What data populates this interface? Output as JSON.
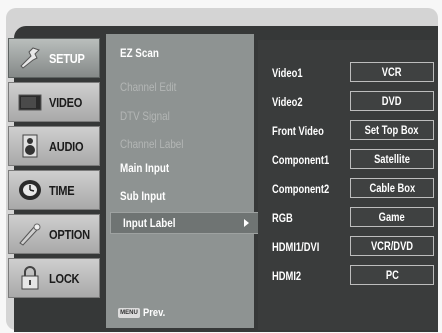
{
  "tabs": [
    {
      "label": "SETUP",
      "icon": "wrench-icon",
      "active": true
    },
    {
      "label": "VIDEO",
      "icon": "tv-icon",
      "active": false
    },
    {
      "label": "AUDIO",
      "icon": "speaker-icon",
      "active": false
    },
    {
      "label": "TIME",
      "icon": "clock-icon",
      "active": false
    },
    {
      "label": "OPTION",
      "icon": "option-icon",
      "active": false
    },
    {
      "label": "LOCK",
      "icon": "lock-icon",
      "active": false
    }
  ],
  "menu": {
    "items": [
      {
        "label": "EZ Scan",
        "enabled": true
      },
      {
        "label": "Channel Edit",
        "enabled": false
      },
      {
        "label": "DTV Signal",
        "enabled": false
      },
      {
        "label": "Channel Label",
        "enabled": false
      },
      {
        "label": "Main Input",
        "enabled": true
      },
      {
        "label": "Sub Input",
        "enabled": true
      }
    ],
    "selected": "Input Label",
    "prev_key": "MENU",
    "prev_label": "Prev."
  },
  "submenu": {
    "rows": [
      {
        "label": "Video1",
        "value": "VCR"
      },
      {
        "label": "Video2",
        "value": "DVD"
      },
      {
        "label": "Front Video",
        "value": "Set Top Box"
      },
      {
        "label": "Component1",
        "value": "Satellite"
      },
      {
        "label": "Component2",
        "value": "Cable Box"
      },
      {
        "label": "RGB",
        "value": "Game"
      },
      {
        "label": "HDMI1/DVI",
        "value": "VCR/DVD"
      },
      {
        "label": "HDMI2",
        "value": "PC"
      }
    ]
  },
  "colors": {
    "panel": "#363838",
    "menu": "#8e9392",
    "tab": "#bdbdbd"
  }
}
